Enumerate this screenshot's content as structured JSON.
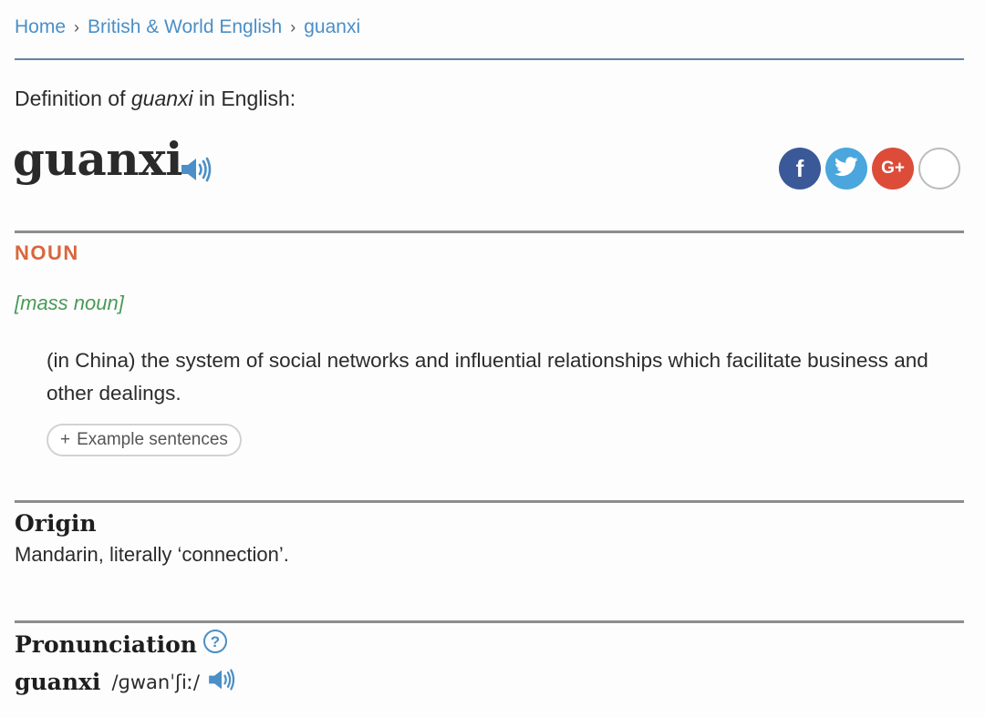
{
  "breadcrumb": {
    "home": "Home",
    "section": "British & World English",
    "entry": "guanxi",
    "separator": "›"
  },
  "definition_intro": {
    "prefix": "Definition of ",
    "term": "guanxi",
    "suffix": " in English:"
  },
  "headword": "guanxi",
  "share": {
    "facebook_glyph": "f",
    "googleplus_glyph": "G+",
    "more_glyph": "+"
  },
  "part_of_speech": "NOUN",
  "grammar_note": "[mass noun]",
  "sense": "(in China) the system of social networks and influential relationships which facilitate business and other dealings.",
  "example_sentences": {
    "icon": "+",
    "label": "Example sentences"
  },
  "origin": {
    "title": "Origin",
    "text": "Mandarin, literally ‘connection’."
  },
  "pronunciation": {
    "title": "Pronunciation",
    "help_glyph": "?",
    "word": "guanxi",
    "ipa": "/ɡwanˈʃiː/"
  },
  "colors": {
    "link": "#4a8fc7",
    "pos": "#d9663d",
    "grammar": "#4a9a57",
    "facebook": "#3b5998",
    "twitter": "#4aa6dd",
    "googleplus": "#dd4b39"
  },
  "icons": [
    "speaker-icon",
    "facebook-icon",
    "twitter-icon",
    "google-plus-icon",
    "plus-icon",
    "help-icon"
  ]
}
